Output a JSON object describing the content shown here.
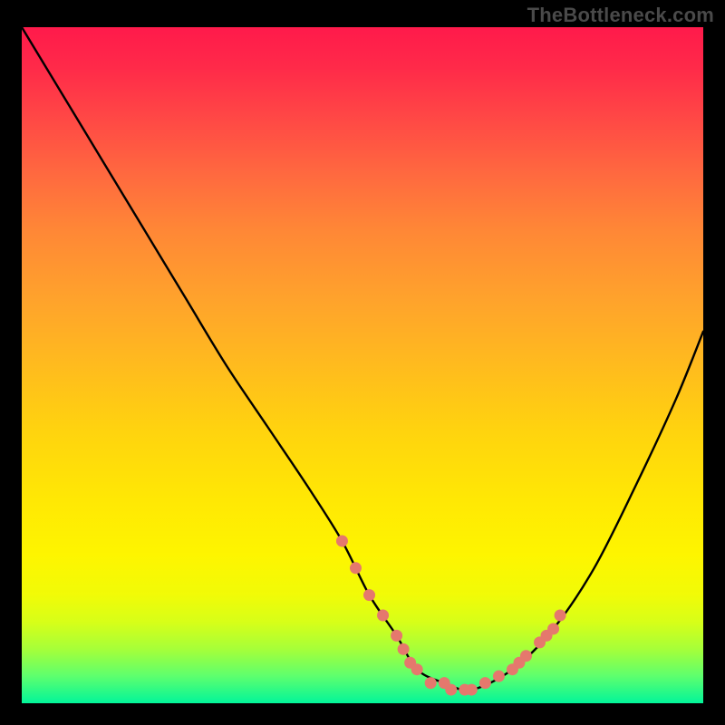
{
  "watermark": "TheBottleneck.com",
  "chart_data": {
    "type": "line",
    "title": "",
    "xlabel": "",
    "ylabel": "",
    "xlim": [
      0,
      100
    ],
    "ylim": [
      0,
      100
    ],
    "grid": false,
    "legend": false,
    "background_gradient": {
      "from": "#ff1a4b",
      "to": "#02f59a",
      "direction": "top-to-bottom",
      "stops": [
        "#ff1a4b",
        "#ff6a3f",
        "#ffbb1e",
        "#fef500",
        "#a6ff39",
        "#02f59a"
      ]
    },
    "series": [
      {
        "name": "bottleneck-curve",
        "color": "#000000",
        "x": [
          0,
          6,
          12,
          18,
          24,
          30,
          36,
          42,
          47,
          51,
          55,
          58,
          62,
          66,
          72,
          78,
          84,
          90,
          96,
          100
        ],
        "values": [
          100,
          90,
          80,
          70,
          60,
          50,
          41,
          32,
          24,
          16,
          10,
          5,
          3,
          2,
          5,
          11,
          20,
          32,
          45,
          55
        ]
      },
      {
        "name": "highlight-segment-left",
        "color": "#e5786d",
        "style": "markers",
        "x": [
          47,
          49,
          51,
          53,
          55,
          56,
          57,
          58
        ],
        "values": [
          24,
          20,
          16,
          13,
          10,
          8,
          6,
          5
        ]
      },
      {
        "name": "highlight-segment-bottom",
        "color": "#e5786d",
        "style": "markers",
        "x": [
          60,
          62,
          63,
          65,
          66,
          68,
          70
        ],
        "values": [
          3,
          3,
          2,
          2,
          2,
          3,
          4
        ]
      },
      {
        "name": "highlight-segment-right",
        "color": "#e5786d",
        "style": "markers",
        "x": [
          72,
          73,
          74,
          76,
          77,
          78,
          79
        ],
        "values": [
          5,
          6,
          7,
          9,
          10,
          11,
          13
        ]
      }
    ],
    "annotations": [
      {
        "text": "TheBottleneck.com",
        "position": "top-right",
        "color": "#4a4a4a"
      }
    ]
  }
}
